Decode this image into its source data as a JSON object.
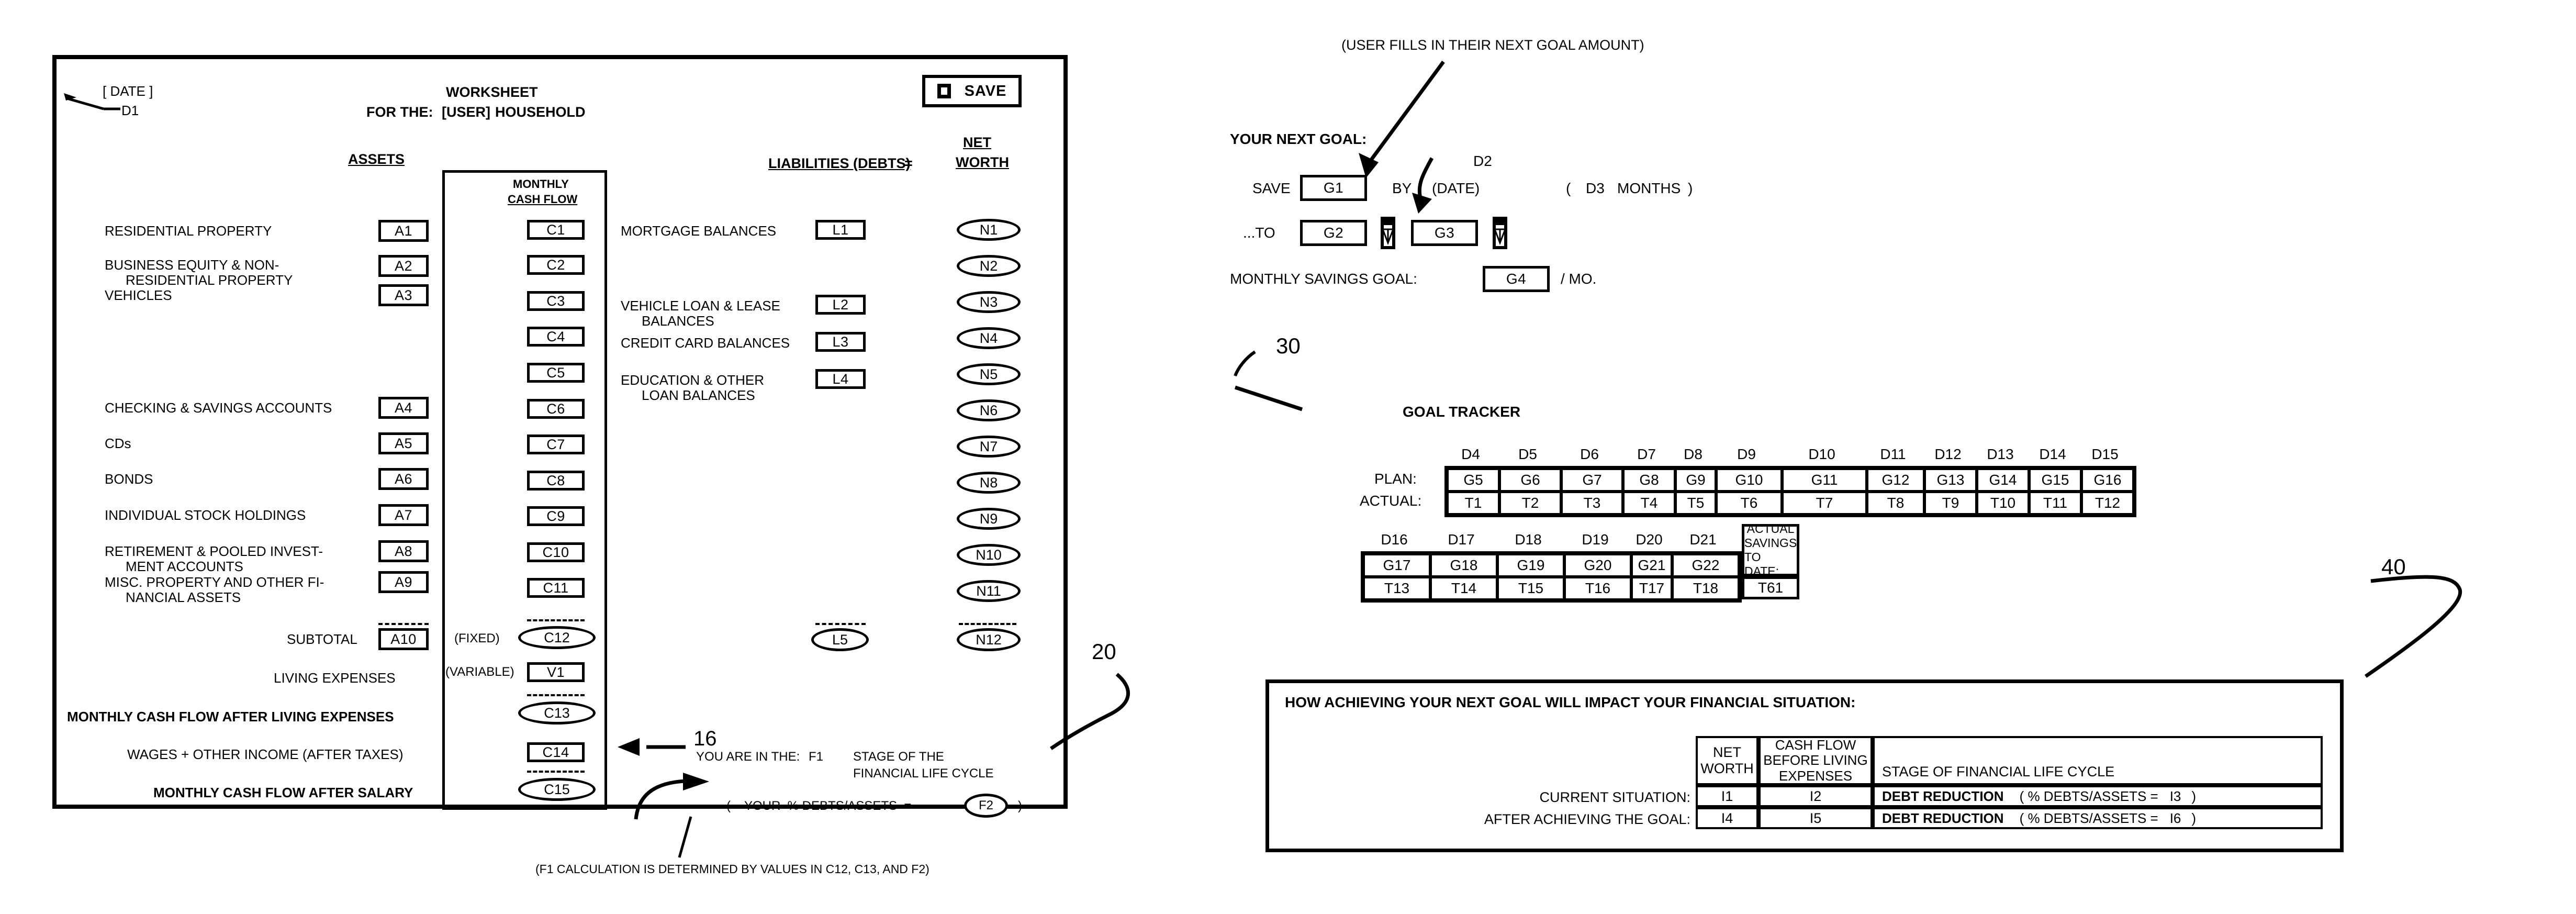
{
  "figure": {
    "ref_worksheet": "20",
    "ref_cashflow_col": "16",
    "ref_goal_tracker": "30",
    "ref_impact_panel": "40"
  },
  "worksheet": {
    "date_label": "[ DATE ]",
    "date_field": "D1",
    "title_line1": "WORKSHEET",
    "title_line2_prefix": "FOR THE:",
    "title_user": "[USER]",
    "title_line2_suffix": "HOUSEHOLD",
    "save_button": {
      "label": "SAVE",
      "icon": "floppy-disk-icon"
    },
    "col_headers": {
      "assets": "ASSETS",
      "cashflow_line1": "MONTHLY",
      "cashflow_line2": "CASH FLOW",
      "liabilities": "LIABILITIES (DEBTS)",
      "equals": "=",
      "networth_line1": "NET",
      "networth_line2": "WORTH"
    },
    "asset_rows": [
      {
        "label": "RESIDENTIAL PROPERTY",
        "field": "A1"
      },
      {
        "label": "BUSINESS EQUITY & NON-",
        "label2": "RESIDENTIAL PROPERTY",
        "field": "A2"
      },
      {
        "label": "VEHICLES",
        "field": "A3"
      },
      {
        "label": "CHECKING & SAVINGS ACCOUNTS",
        "field": "A4"
      },
      {
        "label": "CDs",
        "field": "A5"
      },
      {
        "label": "BONDS",
        "field": "A6"
      },
      {
        "label": "INDIVIDUAL STOCK HOLDINGS",
        "field": "A7"
      },
      {
        "label": "RETIREMENT & POOLED INVEST-",
        "label2": "MENT ACCOUNTS",
        "field": "A8"
      },
      {
        "label": "MISC. PROPERTY AND OTHER FI-",
        "label2": "NANCIAL ASSETS",
        "field": "A9"
      }
    ],
    "asset_subtotal": {
      "label": "SUBTOTAL",
      "field": "A10"
    },
    "cashflow_fields": [
      "C1",
      "C2",
      "C3",
      "C4",
      "C5",
      "C6",
      "C7",
      "C8",
      "C9",
      "C10",
      "C11"
    ],
    "cashflow_fixed_label": "(FIXED)",
    "cashflow_fixed_field": "C12",
    "cashflow_variable_label": "(VARIABLE)",
    "cashflow_variable_field": "V1",
    "cashflow_after_living_field": "C13",
    "cashflow_wages_field": "C14",
    "cashflow_after_salary_field": "C15",
    "living_expenses_label": "LIVING EXPENSES",
    "after_living_label": "MONTHLY CASH FLOW AFTER LIVING EXPENSES",
    "wages_label": "WAGES + OTHER INCOME (AFTER TAXES)",
    "after_salary_label": "MONTHLY CASH FLOW AFTER SALARY",
    "liability_rows": [
      {
        "label": "MORTGAGE BALANCES",
        "field": "L1"
      },
      {
        "label": "VEHICLE LOAN & LEASE",
        "label2": "BALANCES",
        "field": "L2"
      },
      {
        "label": "CREDIT CARD BALANCES",
        "field": "L3"
      },
      {
        "label": "EDUCATION & OTHER",
        "label2": "LOAN BALANCES",
        "field": "L4"
      }
    ],
    "liability_total_field": "L5",
    "networth_fields": [
      "N1",
      "N2",
      "N3",
      "N4",
      "N5",
      "N6",
      "N7",
      "N8",
      "N9",
      "N10",
      "N11"
    ],
    "networth_total_field": "N12",
    "stage_line": {
      "prefix": "YOU ARE IN THE:",
      "field": "F1",
      "suffix_line1": "STAGE OF THE",
      "suffix_line2": "FINANCIAL LIFE CYCLE"
    },
    "ratio_line": {
      "open_paren": "(",
      "label": "YOUR  % DEBTS/ASSETS  =",
      "field": "F2",
      "close_paren": ")"
    },
    "footnote": "(F1 CALCULATION IS DETERMINED BY VALUES IN C12, C13, AND F2)"
  },
  "goal": {
    "callout": "(USER FILLS IN THEIR NEXT GOAL AMOUNT)",
    "heading": "YOUR NEXT GOAL:",
    "save_label": "SAVE",
    "save_field": "G1",
    "by_label": "BY",
    "date_ref": "D2",
    "date_placeholder": "(DATE)",
    "months_open": "(",
    "months_field": "D3",
    "months_label": "MONTHS",
    "months_close": ")",
    "to_label": "...TO",
    "to_field_1": "G2",
    "to_field_2": "G3",
    "dropdown_icon": "chevron-down-icon",
    "monthly_label": "MONTHLY SAVINGS GOAL:",
    "monthly_field": "G4",
    "monthly_suffix": "/ MO."
  },
  "goal_tracker": {
    "title": "GOAL TRACKER",
    "row_label_plan": "PLAN:",
    "row_label_actual": "ACTUAL:",
    "table1": {
      "headers": [
        "D4",
        "D5",
        "D6",
        "D7",
        "D8",
        "D9",
        "D10",
        "D11",
        "D12",
        "D13",
        "D14",
        "D15"
      ],
      "plan": [
        "G5",
        "G6",
        "G7",
        "G8",
        "G9",
        "G10",
        "G11",
        "G12",
        "G13",
        "G14",
        "G15",
        "G16"
      ],
      "actual": [
        "T1",
        "T2",
        "T3",
        "T4",
        "T5",
        "T6",
        "T7",
        "T8",
        "T9",
        "T10",
        "T11",
        "T12"
      ],
      "widths": [
        100,
        118,
        118,
        100,
        78,
        126,
        162,
        110,
        100,
        100,
        100,
        100
      ]
    },
    "table2": {
      "headers": [
        "D16",
        "D17",
        "D18",
        "D19",
        "D20",
        "D21"
      ],
      "plan": [
        "G17",
        "G18",
        "G19",
        "G20",
        "G21",
        "G22"
      ],
      "actual": [
        "T13",
        "T14",
        "T15",
        "T16",
        "T17",
        "T18"
      ],
      "widths": [
        128,
        128,
        128,
        128,
        78,
        128
      ],
      "total_header_line1": "ACTUAL",
      "total_header_line2": "SAVINGS",
      "total_header_line3": "TO DATE:",
      "total_value": "T61"
    }
  },
  "impact": {
    "title": "HOW ACHIEVING YOUR NEXT GOAL WILL IMPACT YOUR FINANCIAL SITUATION:",
    "col_networth_l1": "NET",
    "col_networth_l2": "WORTH",
    "col_cashflow_l1": "CASH FLOW",
    "col_cashflow_l2": "BEFORE LIVING",
    "col_cashflow_l3": "EXPENSES",
    "col_stage": "STAGE OF FINANCIAL LIFE CYCLE",
    "rows": [
      {
        "label": "CURRENT SITUATION:",
        "networth": "I1",
        "cashflow": "I2",
        "stage_name": "DEBT REDUCTION",
        "ratio_prefix": "(    % DEBTS/ASSETS  =",
        "ratio_value": "I3",
        "ratio_suffix": ")"
      },
      {
        "label": "AFTER ACHIEVING THE GOAL:",
        "networth": "I4",
        "cashflow": "I5",
        "stage_name": "DEBT REDUCTION",
        "ratio_prefix": "(    % DEBTS/ASSETS  =",
        "ratio_value": "I6",
        "ratio_suffix": ")"
      }
    ]
  }
}
